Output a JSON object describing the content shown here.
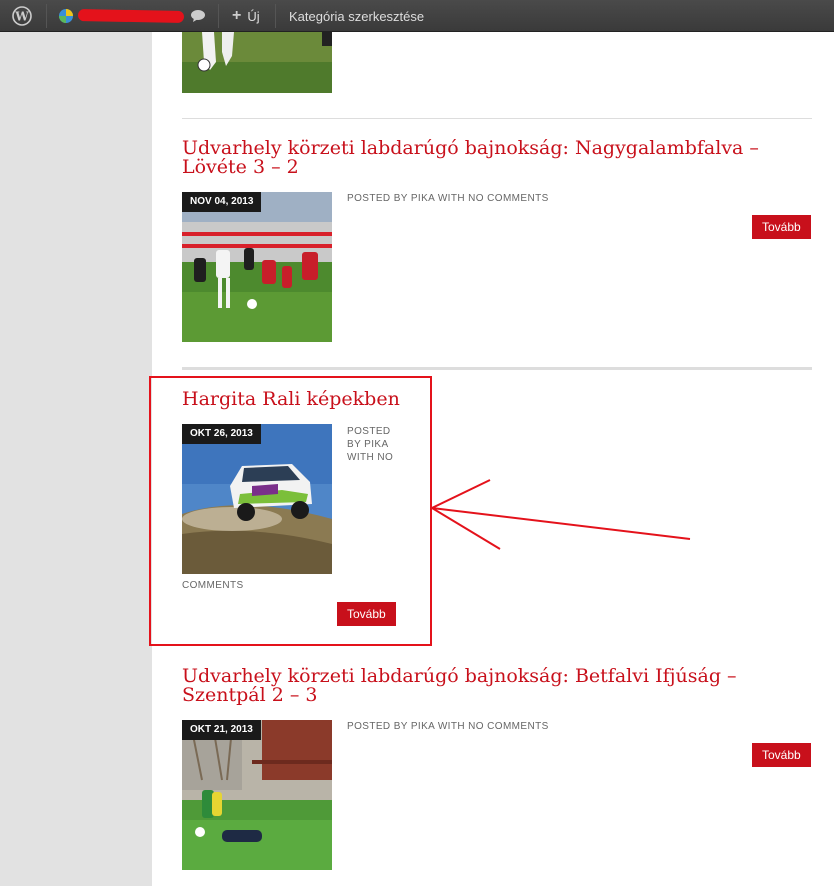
{
  "adminbar": {
    "wp_icon": "wordpress-logo-icon",
    "site_icon": "site-globe-icon",
    "comments_icon": "comment-bubble-icon",
    "new_label": "Új",
    "edit_category_label": "Kategória szerkesztése"
  },
  "posts": [
    {
      "title_line1": "Udvarhely körzeti labdarúgó bajnokság: Nagygalambfalva –",
      "title_line2": "Lövéte 3 – 2",
      "date": "NOV 04, 2013",
      "meta": "POSTED BY PIKA WITH NO COMMENTS",
      "button": "Tovább"
    },
    {
      "title": "Hargita Rali képekben",
      "date": "OKT 26, 2013",
      "meta_lines": [
        "POSTED",
        "BY PIKA",
        "WITH NO"
      ],
      "meta_tail": "COMMENTS",
      "button": "Tovább"
    },
    {
      "title_line1": "Udvarhely körzeti labdarúgó bajnokság: Betfalvi Ifjúság –",
      "title_line2": "Szentpál 2 – 3",
      "date": "OKT 21, 2013",
      "meta": "POSTED BY PIKA WITH NO COMMENTS",
      "button": "Tovább"
    }
  ],
  "colors": {
    "accent": "#c8101b",
    "annotation": "#e4121b",
    "adminbar": "#464646",
    "sidebar": "#e2e2e2"
  }
}
